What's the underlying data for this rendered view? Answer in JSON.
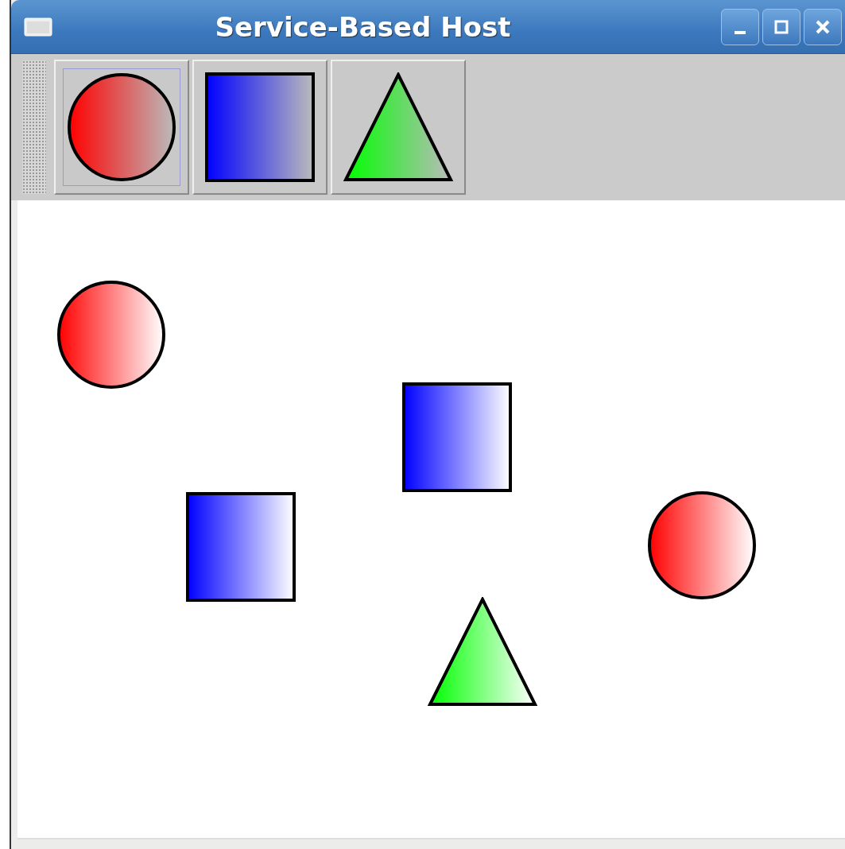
{
  "window": {
    "title": "Service-Based Host"
  },
  "tools": [
    {
      "kind": "circle",
      "selected": true
    },
    {
      "kind": "square",
      "selected": false
    },
    {
      "kind": "triangle",
      "selected": false
    }
  ],
  "canvas": {
    "shapes": [
      {
        "kind": "circle"
      },
      {
        "kind": "square"
      },
      {
        "kind": "square"
      },
      {
        "kind": "circle"
      },
      {
        "kind": "triangle"
      }
    ]
  }
}
